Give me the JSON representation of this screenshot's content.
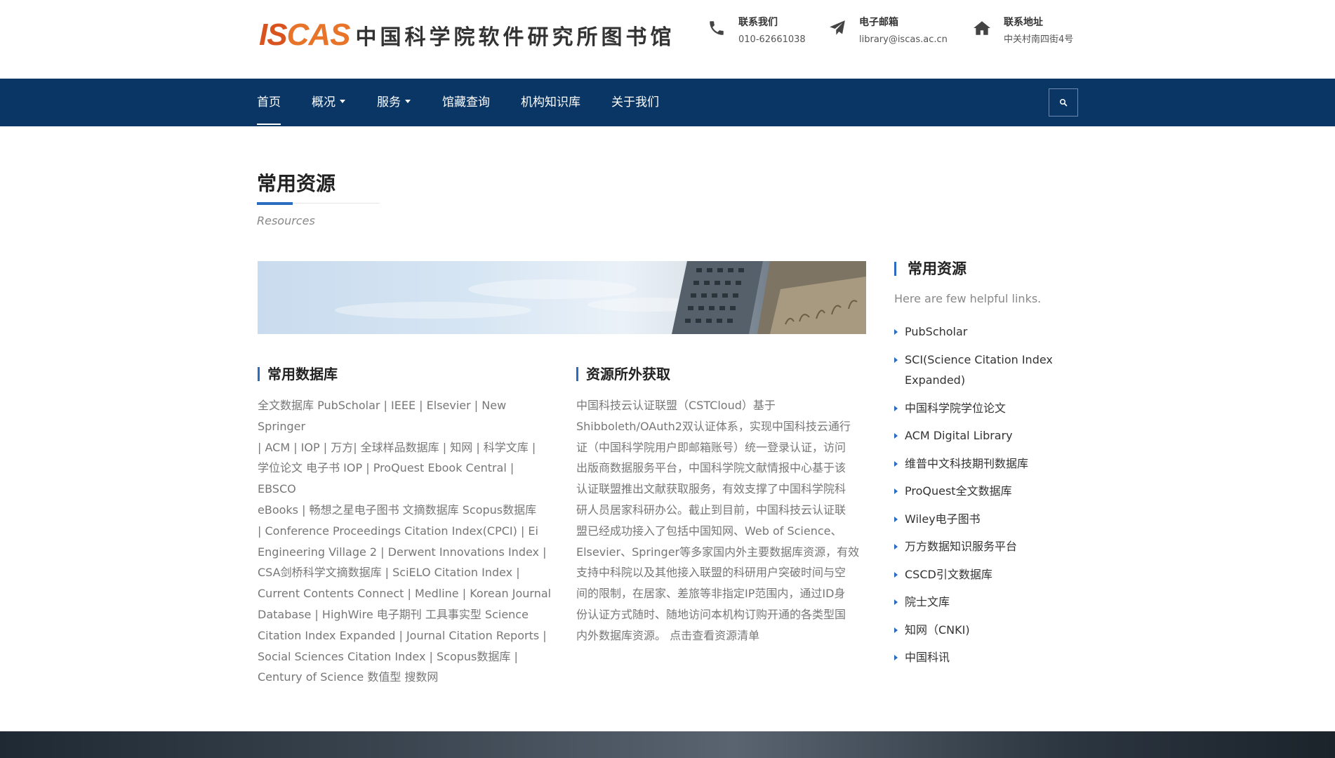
{
  "header": {
    "logo_mark_a": "IS",
    "logo_mark_b": "CAS",
    "logo_text": "中国科学院软件研究所图书馆",
    "contacts": [
      {
        "icon": "phone-icon",
        "label": "联系我们",
        "value": "010-62661038"
      },
      {
        "icon": "paper-plane-icon",
        "label": "电子邮箱",
        "value": "library@iscas.ac.cn"
      },
      {
        "icon": "home-icon",
        "label": "联系地址",
        "value": "中关村南四街4号"
      }
    ]
  },
  "nav": {
    "items": [
      {
        "label": "首页",
        "active": true,
        "dropdown": false
      },
      {
        "label": "概况",
        "active": false,
        "dropdown": true
      },
      {
        "label": "服务",
        "active": false,
        "dropdown": true
      },
      {
        "label": "馆藏查询",
        "active": false,
        "dropdown": false
      },
      {
        "label": "机构知识库",
        "active": false,
        "dropdown": false
      },
      {
        "label": "关于我们",
        "active": false,
        "dropdown": false
      }
    ],
    "search_icon": "search-icon"
  },
  "page": {
    "title": "常用资源",
    "subtitle": "Resources"
  },
  "content": {
    "databases": {
      "heading": "常用数据库",
      "lines": [
        "全文数据库 PubScholar | IEEE | Elsevier | New Springer",
        "| ACM | IOP | 万方| 全球样品数据库 | 知网 | 科学文库 |",
        "学位论文 电子书 IOP | ProQuest Ebook Central | EBSCO",
        "eBooks | 畅想之星电子图书 文摘数据库 Scopus数据库",
        "| Conference Proceedings Citation Index(CPCI) | Ei",
        "Engineering Village 2 | Derwent Innovations Index |",
        "CSA剑桥科学文摘数据库 | SciELO Citation Index |",
        "Current Contents Connect | Medline | Korean Journal",
        "Database | HighWire 电子期刊 工具事实型 Science",
        "Citation Index Expanded | Journal Citation Reports |",
        "Social Sciences Citation Index | Scopus数据库 |",
        "Century of Science 数值型 搜数网"
      ]
    },
    "remote_access": {
      "heading": "资源所外获取",
      "lines": [
        "中国科技云认证联盟（CSTCloud）基于",
        "Shibboleth/OAuth2双认证体系，实现中国科技云通行",
        "证（中国科学院用户即邮箱账号）统一登录认证，访问",
        "出版商数据服务平台，中国科学院文献情报中心基于该",
        "认证联盟推出文献获取服务，有效支撑了中国科学院科",
        "研人员居家科研办公。截止到目前，中国科技云认证联",
        "盟已经成功接入了包括中国知网、Web of Science、",
        "Elsevier、Springer等多家国内外主要数据库资源，有效",
        "支持中科院以及其他接入联盟的科研用户突破时间与空",
        "间的限制，在居家、差旅等非指定IP范围内，通过ID身",
        "份认证方式随时、随地访问本机构订购开通的各类型国",
        "内外数据库资源。 点击查看资源清单"
      ]
    }
  },
  "sidebar": {
    "heading": "常用资源",
    "description": "Here are few helpful links.",
    "links": [
      "PubScholar",
      "SCI(Science Citation Index Expanded)",
      "中国科学院学位论文",
      "ACM Digital Library",
      "维普中文科技期刊数据库",
      "ProQuest全文数据库",
      "Wiley电子图书",
      "万方数据知识服务平台",
      "CSCD引文数据库",
      "院士文库",
      "知网（CNKI)",
      "中国科讯"
    ]
  },
  "colors": {
    "nav_bg": "#0a3665",
    "accent": "#2a6cbf",
    "logo_orange": "#d9531e"
  }
}
